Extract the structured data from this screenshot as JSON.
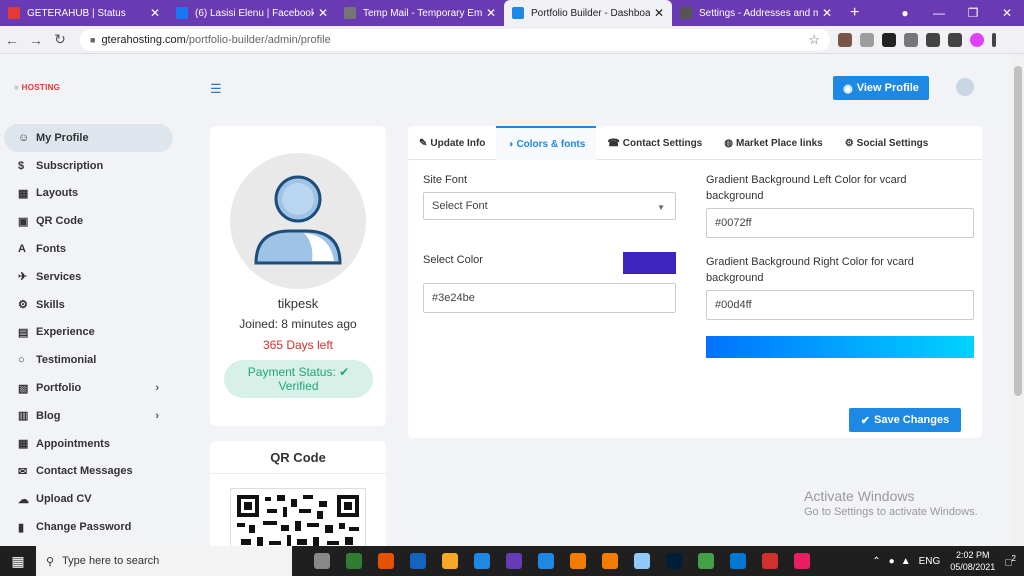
{
  "browser": {
    "tabs": [
      {
        "title": "GETERAHUB | Status",
        "color": "#e53935",
        "active": false
      },
      {
        "title": "(6) Lasisi Elenu | Facebook",
        "color": "#1877f2",
        "active": false
      },
      {
        "title": "Temp Mail - Temporary Email",
        "color": "#757575",
        "active": false
      },
      {
        "title": "Portfolio Builder - Dashboard",
        "color": "#1e88e5",
        "active": true
      },
      {
        "title": "Settings - Addresses and mo",
        "color": "#555555",
        "active": false
      }
    ],
    "new_tab": "+",
    "url_host": "gterahosting.com",
    "url_path": "/portfolio-builder/admin/profile"
  },
  "header": {
    "logo_text": "HOSTING",
    "menu_icon": "hamburger-icon",
    "view_profile_label": "View Profile"
  },
  "sidebar": {
    "items": [
      {
        "label": "My Profile",
        "icon": "user-icon",
        "glyph": "☺",
        "active": true,
        "chevron": false
      },
      {
        "label": "Subscription",
        "icon": "dollar-icon",
        "glyph": "$",
        "active": false,
        "chevron": false
      },
      {
        "label": "Layouts",
        "icon": "layout-icon",
        "glyph": "▦",
        "active": false,
        "chevron": false
      },
      {
        "label": "QR Code",
        "icon": "qr-icon",
        "glyph": "▣",
        "active": false,
        "chevron": false
      },
      {
        "label": "Fonts",
        "icon": "font-icon",
        "glyph": "A",
        "active": false,
        "chevron": false
      },
      {
        "label": "Services",
        "icon": "rocket-icon",
        "glyph": "✈",
        "active": false,
        "chevron": false
      },
      {
        "label": "Skills",
        "icon": "cogs-icon",
        "glyph": "⚙",
        "active": false,
        "chevron": false
      },
      {
        "label": "Experience",
        "icon": "briefcase-icon",
        "glyph": "▤",
        "active": false,
        "chevron": false
      },
      {
        "label": "Testimonial",
        "icon": "comment-icon",
        "glyph": "○",
        "active": false,
        "chevron": false
      },
      {
        "label": "Portfolio",
        "icon": "portfolio-icon",
        "glyph": "▧",
        "active": false,
        "chevron": true
      },
      {
        "label": "Blog",
        "icon": "blog-icon",
        "glyph": "▥",
        "active": false,
        "chevron": true
      },
      {
        "label": "Appointments",
        "icon": "calendar-icon",
        "glyph": "▦",
        "active": false,
        "chevron": false
      },
      {
        "label": "Contact Messages",
        "icon": "envelope-icon",
        "glyph": "✉",
        "active": false,
        "chevron": false
      },
      {
        "label": "Upload CV",
        "icon": "upload-icon",
        "glyph": "☁",
        "active": false,
        "chevron": false
      },
      {
        "label": "Change Password",
        "icon": "lock-icon",
        "glyph": "▮",
        "active": false,
        "chevron": false
      }
    ]
  },
  "profile": {
    "username": "tikpesk",
    "joined": "Joined: 8 minutes ago",
    "days_left": "365 Days left",
    "payment_status": "Payment Status:",
    "payment_value": "Verified"
  },
  "qr": {
    "title": "QR Code"
  },
  "settings": {
    "tabs": [
      {
        "label": "Update Info",
        "icon": "edit-icon",
        "glyph": "✎",
        "active": false
      },
      {
        "label": "Colors & fonts",
        "icon": "palette-icon",
        "glyph": "◑",
        "active": true
      },
      {
        "label": "Contact Settings",
        "icon": "phone-icon",
        "glyph": "☎",
        "active": false
      },
      {
        "label": "Market Place links",
        "icon": "globe-icon",
        "glyph": "◍",
        "active": false
      },
      {
        "label": "Social Settings",
        "icon": "gear-icon",
        "glyph": "⚙",
        "active": false
      }
    ],
    "site_font_label": "Site Font",
    "site_font_value": "Select Font",
    "select_color_label": "Select Color",
    "select_color_value": "#3e24be",
    "grad_left_label": "Gradient Background Left Color for vcard background",
    "grad_left_value": "#0072ff",
    "grad_right_label": "Gradient Background Right Color for vcard background",
    "grad_right_value": "#00d4ff",
    "save_label": "Save Changes"
  },
  "watermark": {
    "line1": "Activate Windows",
    "line2": "Go to Settings to activate Windows."
  },
  "taskbar": {
    "search_placeholder": "Type here to search",
    "lang": "ENG",
    "time": "2:02 PM",
    "date": "05/08/2021",
    "notifications": "2",
    "apps": [
      "#888888",
      "#2e7d32",
      "#e65100",
      "#1565c0",
      "#f9a825",
      "#1e88e5",
      "#673ab7",
      "#1e88e5",
      "#f57c00",
      "#f57c00",
      "#90caf9",
      "#001e36",
      "#43a047",
      "#0078d4",
      "#d32f2f",
      "#e91e63"
    ]
  }
}
